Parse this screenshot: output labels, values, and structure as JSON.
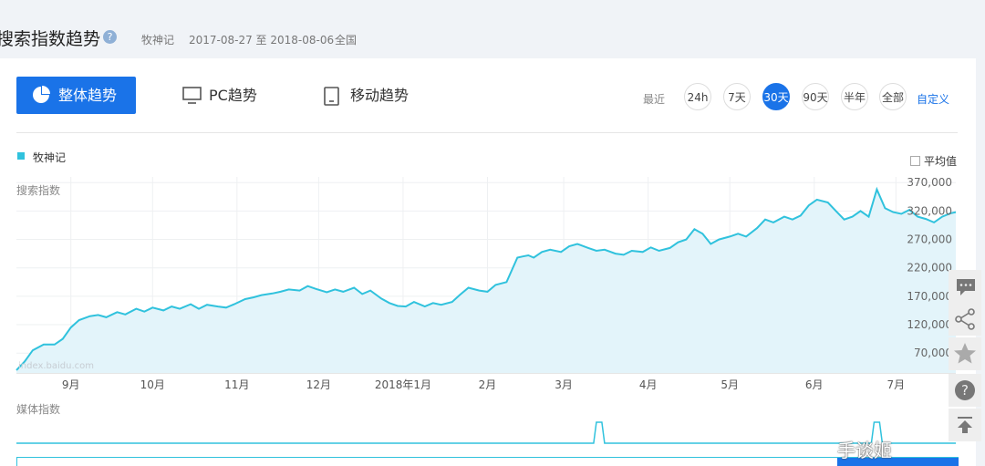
{
  "header": {
    "title": "搜索指数趋势",
    "keyword": "牧神记",
    "date_range": "2017-08-27 至 2018-08-06",
    "region": "全国"
  },
  "tabs": [
    {
      "label": "整体趋势",
      "icon": "pie-icon",
      "active": true
    },
    {
      "label": "PC趋势",
      "icon": "monitor-icon",
      "active": false
    },
    {
      "label": "移动趋势",
      "icon": "phone-icon",
      "active": false
    }
  ],
  "range": {
    "label": "最近",
    "options": [
      "24h",
      "7天",
      "30天",
      "90天",
      "半年",
      "全部"
    ],
    "active": "30天",
    "custom": "自定义"
  },
  "legend": {
    "series": "牧神记",
    "color": "#30c2dd",
    "avg_label": "平均值"
  },
  "chart_titles": {
    "search": "搜索指数",
    "media": "媒体指数"
  },
  "watermark_site": "index.baidu.com",
  "watermark": "手谈姬",
  "sidebar_icons": [
    "chat-icon",
    "share-icon",
    "star-icon",
    "help-icon",
    "back-to-top-icon"
  ],
  "chart_data": {
    "type": "area",
    "ylabel": "搜索指数",
    "yticks": [
      "370,000",
      "320,000",
      "270,000",
      "220,000",
      "170,000",
      "120,000",
      "70,000"
    ],
    "ytick_values": [
      370000,
      320000,
      270000,
      220000,
      170000,
      120000,
      70000
    ],
    "ylim": [
      35000,
      380000
    ],
    "xtick_labels": [
      "9月",
      "10月",
      "11月",
      "12月",
      "2018年1月",
      "2月",
      "3月",
      "4月",
      "5月",
      "6月",
      "7月"
    ],
    "xlim": [
      0,
      345
    ],
    "xtick_positions": [
      20,
      50,
      81,
      111,
      142,
      173,
      201,
      232,
      262,
      293,
      323
    ],
    "grid": true,
    "series": [
      {
        "name": "牧神记",
        "x": [
          0,
          3,
          6,
          10,
          14,
          17,
          20,
          23,
          27,
          30,
          33,
          37,
          40,
          44,
          47,
          50,
          54,
          57,
          60,
          64,
          67,
          70,
          74,
          77,
          80,
          84,
          87,
          90,
          94,
          97,
          100,
          104,
          107,
          110,
          114,
          117,
          120,
          124,
          127,
          130,
          134,
          137,
          140,
          143,
          146,
          150,
          153,
          156,
          160,
          163,
          166,
          170,
          173,
          176,
          180,
          184,
          186,
          188,
          190,
          193,
          196,
          200,
          203,
          206,
          210,
          213,
          216,
          220,
          223,
          226,
          230,
          233,
          236,
          240,
          243,
          246,
          249,
          252,
          255,
          258,
          262,
          265,
          268,
          272,
          275,
          278,
          282,
          285,
          288,
          291,
          294,
          298,
          301,
          304,
          307,
          310,
          313,
          316,
          319,
          322,
          325,
          328,
          331,
          334,
          337,
          340,
          343,
          345
        ],
        "values": [
          40000,
          55000,
          75000,
          85000,
          85000,
          95000,
          115000,
          128000,
          135000,
          137000,
          133000,
          142000,
          138000,
          148000,
          143000,
          150000,
          145000,
          152000,
          148000,
          156000,
          148000,
          155000,
          152000,
          150000,
          156000,
          165000,
          168000,
          172000,
          175000,
          178000,
          182000,
          180000,
          188000,
          183000,
          177000,
          182000,
          178000,
          185000,
          174000,
          180000,
          166000,
          158000,
          153000,
          152000,
          160000,
          152000,
          158000,
          155000,
          160000,
          173000,
          185000,
          180000,
          178000,
          190000,
          195000,
          238000,
          240000,
          242000,
          238000,
          248000,
          252000,
          248000,
          258000,
          262000,
          255000,
          250000,
          252000,
          245000,
          243000,
          250000,
          248000,
          256000,
          250000,
          255000,
          265000,
          270000,
          288000,
          280000,
          262000,
          270000,
          275000,
          280000,
          275000,
          290000,
          305000,
          300000,
          310000,
          305000,
          312000,
          330000,
          340000,
          335000,
          320000,
          305000,
          310000,
          320000,
          310000,
          358000,
          325000,
          318000,
          315000,
          322000,
          310000,
          306000,
          300000,
          310000,
          316000,
          318000
        ]
      }
    ],
    "media": {
      "x": [
        0,
        210,
        212,
        214,
        216,
        218,
        345
      ],
      "values": [
        0,
        0,
        0,
        1,
        1,
        0,
        0
      ],
      "x2": [
        0,
        314,
        316,
        318,
        320,
        345
      ],
      "values2": [
        0,
        0,
        1,
        1,
        0,
        0
      ]
    }
  }
}
